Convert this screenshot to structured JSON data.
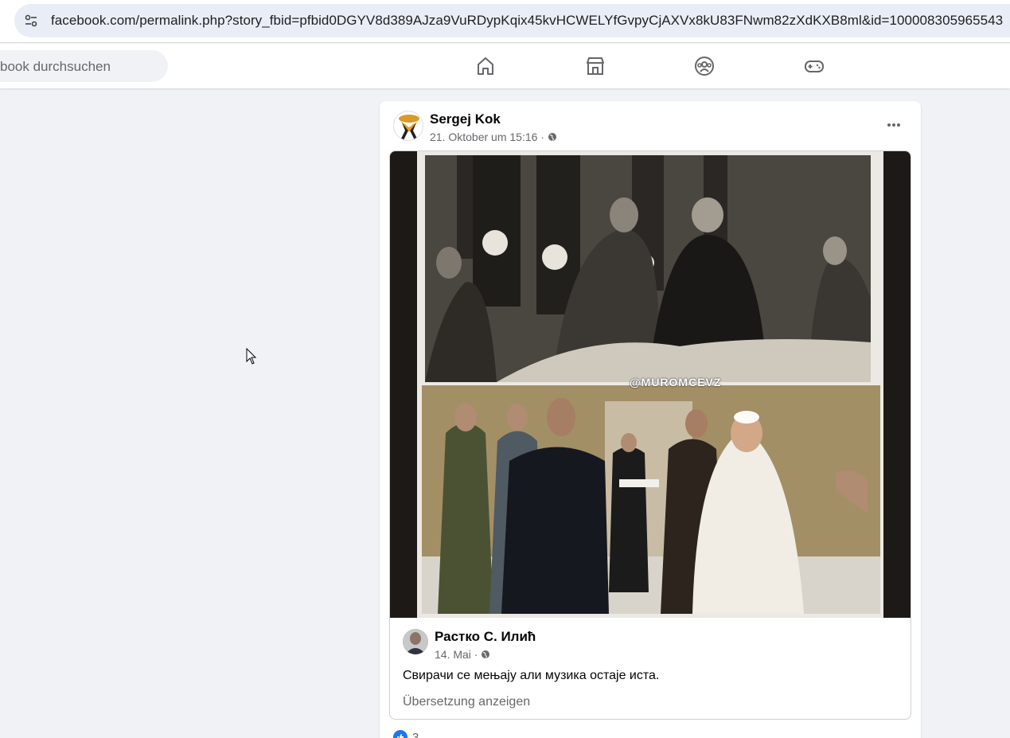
{
  "browser": {
    "url": "facebook.com/permalink.php?story_fbid=pfbid0DGYV8d389AJza9VuRDypKqix45kvHCWELYfGvpyCjAXVx8kU83FNwm82zXdKXB8ml&id=100008305965543",
    "site_info_icon": "tune-icon"
  },
  "header": {
    "search_text": "book durchsuchen",
    "nav_icons": [
      "home-icon",
      "marketplace-icon",
      "groups-icon",
      "gaming-icon"
    ]
  },
  "post": {
    "author": "Sergej Kok",
    "timestamp": "21. Oktober um 15:16 ·",
    "audience_icon": "globe-icon",
    "more_icon": "more-options-icon",
    "shared": {
      "watermark": "@MUROMCEVZ",
      "author": "Растко С. Илић",
      "timestamp": "14. Mai ·",
      "text": "Свирачи се мењају али музика остаје иста.",
      "translate_label": "Übersetzung anzeigen"
    },
    "reactions": {
      "icon": "like-icon",
      "count": "3"
    }
  },
  "colors": {
    "accent": "#1877f2",
    "background": "#f0f2f5",
    "secondary_text": "#65676b"
  }
}
